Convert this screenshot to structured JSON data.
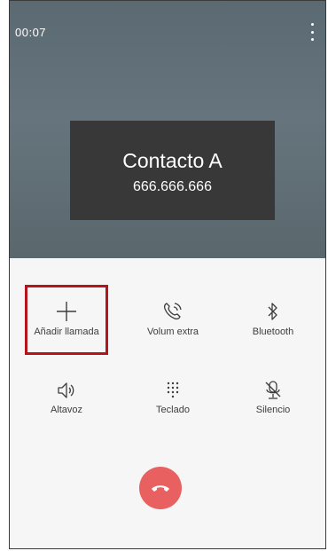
{
  "status": {
    "timer": "00:07"
  },
  "contact": {
    "name": "Contacto A",
    "number": "666.666.666"
  },
  "controls": {
    "add_call": "Añadir llamada",
    "extra_volume": "Volum extra",
    "bluetooth": "Bluetooth",
    "speaker": "Altavoz",
    "keypad": "Teclado",
    "mute": "Silencio"
  },
  "colors": {
    "top_bg": "#5b6a72",
    "contact_box": "#383838",
    "highlight": "#b5141b",
    "hangup": "#e86060",
    "icon": "#3d3d3d"
  },
  "icons": {
    "add_call": "plus-icon",
    "extra_volume": "phone-volume-icon",
    "bluetooth": "bluetooth-icon",
    "speaker": "speaker-icon",
    "keypad": "dialpad-icon",
    "mute": "mic-off-icon",
    "hangup": "phone-hangup-icon",
    "menu": "more-vertical-icon"
  }
}
